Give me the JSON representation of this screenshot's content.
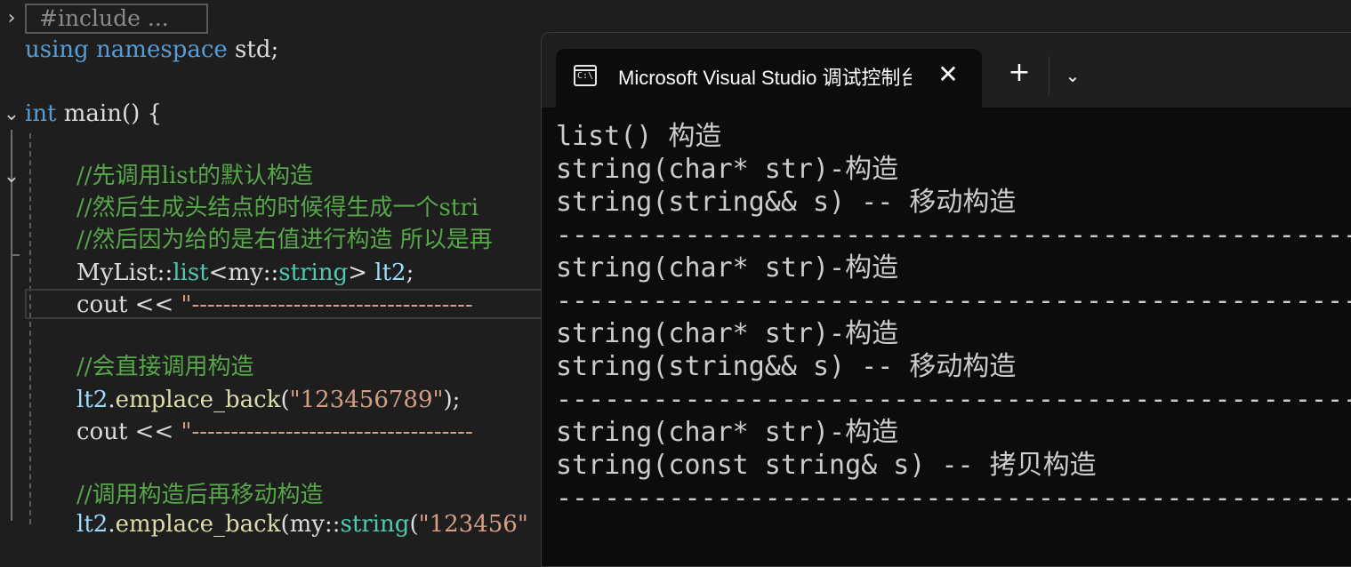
{
  "editor": {
    "collapsed_include": "#include ...",
    "lines": {
      "using_kw1": "using",
      "using_kw2": "namespace",
      "using_rest": " std;",
      "main_kw": "int",
      "main_rest": " main() {",
      "c1": "//先调用list的默认构造",
      "c2": "//然后生成头结点的时候得生成一个stri",
      "c3": "//然后因为给的是右值进行构造 所以是再",
      "decl_a": "MyList::",
      "decl_b": "list",
      "decl_c": "<my::",
      "decl_d": "string",
      "decl_e": "> ",
      "decl_f": "lt2",
      "decl_g": ";",
      "cout1_a": "cout << ",
      "cout1_b": "\"------------------------------------",
      "c4": "//会直接调用构造",
      "emp1_a": "lt2",
      "emp1_b": ".",
      "emp1_c": "emplace_back",
      "emp1_d": "(",
      "emp1_e": "\"123456789\"",
      "emp1_f": ");",
      "cout2_a": "cout << ",
      "cout2_b": "\"------------------------------------",
      "c5": "//调用构造后再移动构造",
      "emp2_a": "lt2",
      "emp2_b": ".",
      "emp2_c": "emplace_back",
      "emp2_d": "(my::",
      "emp2_e": "string",
      "emp2_f": "(",
      "emp2_g": "\"123456\""
    }
  },
  "terminal": {
    "tab_title": "Microsoft Visual Studio 调试控制台",
    "icon_text": "C:\\",
    "new_tab": "+",
    "close": "✕",
    "dropdown": "⌄",
    "output": [
      "list() 构造",
      "string(char* str)-构造",
      "string(string&& s) -- 移动构造",
      "--------------------------------------------------",
      "string(char* str)-构造",
      "--------------------------------------------------",
      "string(char* str)-构造",
      "string(string&& s) -- 移动构造",
      "--------------------------------------------------",
      "string(char* str)-构造",
      "string(const string& s) -- 拷贝构造",
      "--------------------------------------------------"
    ]
  },
  "colors": {
    "keyword": "#569cd6",
    "type": "#4ec9b0",
    "comment": "#57a64a",
    "string": "#d69d85",
    "variable": "#9cdcfe",
    "function": "#dcdcaa",
    "terminal_bg": "#0c0c0c",
    "editor_bg": "#1e1e1e"
  }
}
